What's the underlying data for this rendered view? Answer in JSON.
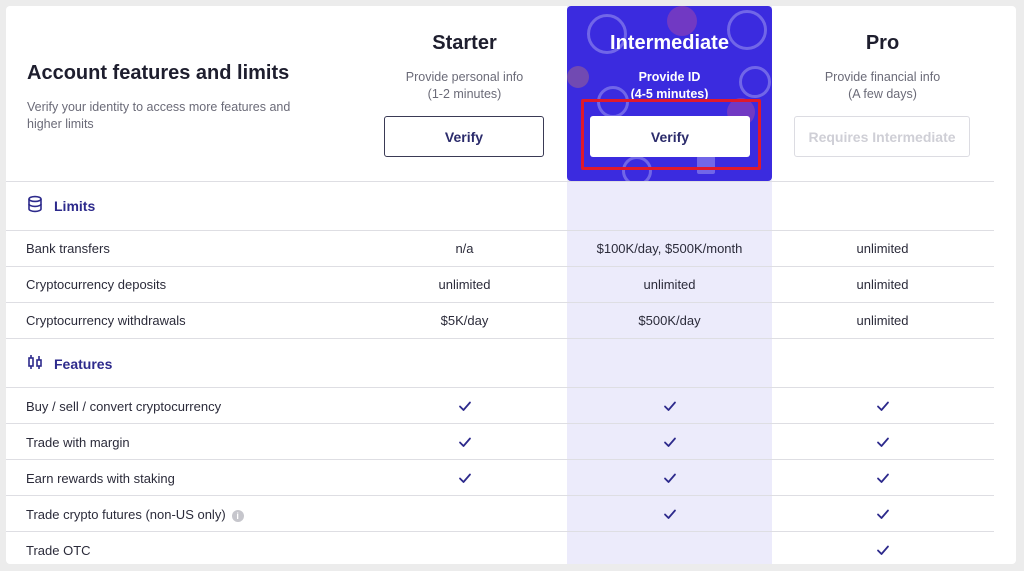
{
  "header": {
    "title": "Account features and limits",
    "subtitle": "Verify your identity to access more features and higher limits"
  },
  "tiers": [
    {
      "name": "Starter",
      "desc1": "Provide personal info",
      "desc2": "(1-2 minutes)",
      "button": "Verify"
    },
    {
      "name": "Intermediate",
      "desc1": "Provide ID",
      "desc2": "(4-5 minutes)",
      "button": "Verify"
    },
    {
      "name": "Pro",
      "desc1": "Provide financial info",
      "desc2": "(A few days)",
      "button": "Requires Intermediate"
    }
  ],
  "sections": {
    "limits": {
      "label": "Limits",
      "rows": [
        {
          "label": "Bank transfers",
          "starter": "n/a",
          "intermediate": "$100K/day, $500K/month",
          "pro": "unlimited"
        },
        {
          "label": "Cryptocurrency deposits",
          "starter": "unlimited",
          "intermediate": "unlimited",
          "pro": "unlimited"
        },
        {
          "label": "Cryptocurrency withdrawals",
          "starter": "$5K/day",
          "intermediate": "$500K/day",
          "pro": "unlimited"
        }
      ]
    },
    "features": {
      "label": "Features",
      "rows": [
        {
          "label": "Buy / sell / convert cryptocurrency",
          "starter": true,
          "intermediate": true,
          "pro": true
        },
        {
          "label": "Trade with margin",
          "starter": true,
          "intermediate": true,
          "pro": true
        },
        {
          "label": "Earn rewards with staking",
          "starter": true,
          "intermediate": true,
          "pro": true
        },
        {
          "label": "Trade crypto futures (non-US only)",
          "starter": false,
          "intermediate": true,
          "pro": true,
          "info": "i"
        },
        {
          "label": "Trade OTC",
          "starter": false,
          "intermediate": false,
          "pro": true
        }
      ]
    }
  },
  "colors": {
    "accent": "#3b2bdf",
    "highlight_column": "#ecebfb",
    "annotation_box": "#e0192b",
    "check": "#2d2a8c"
  },
  "icons": {
    "limits": "database-stack-icon",
    "features": "candlestick-chart-icon",
    "check": "checkmark-icon",
    "info": "info-icon"
  }
}
